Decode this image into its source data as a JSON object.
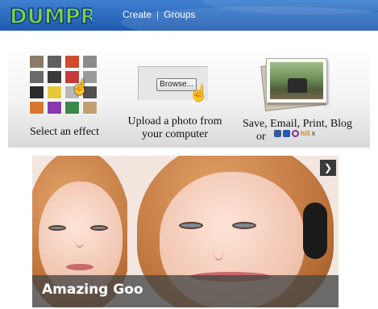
{
  "app": {
    "logo_text": "DUMPR"
  },
  "nav": {
    "items": [
      {
        "label": "Create"
      },
      {
        "label": "Groups"
      }
    ],
    "separator": "|"
  },
  "steps": [
    {
      "label_lines": [
        "Select an effect"
      ]
    },
    {
      "label_lines": [
        "Upload a photo from",
        "your computer"
      ],
      "browse_button": "Browse..."
    },
    {
      "label_lines": [
        "Save, Email, Print, Blog",
        "or"
      ]
    }
  ],
  "share_icons": [
    "facebook-icon",
    "myspace-icon",
    "orkut-icon",
    "hi5-icon",
    "xanga-icon"
  ],
  "share_texts": {
    "hi5": "hi5",
    "x": "x"
  },
  "slideshow": {
    "caption": "Amazing Goo",
    "next_label": "❯"
  },
  "colors": {
    "header_top": "#3f7fd0",
    "header_bottom": "#1f5bb0",
    "caption_bar": "#464646"
  }
}
